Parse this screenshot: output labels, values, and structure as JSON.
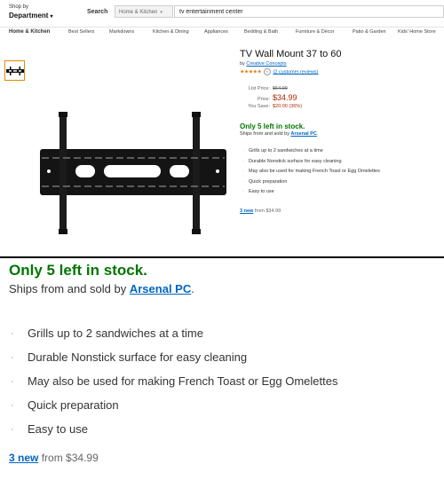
{
  "header": {
    "shop_by": "Shop by",
    "department": "Department",
    "search_label": "Search",
    "search_category": "Home & Kitchen",
    "search_query": "tv entertainment center"
  },
  "subnav": {
    "items": [
      "Home & Kitchen",
      "Best Sellers",
      "Markdowns",
      "Kitchen & Dining",
      "Appliances",
      "Bedding & Bath",
      "Furniture & Décor",
      "Patio & Garden",
      "Kids' Home Store"
    ]
  },
  "product": {
    "title": "TV Wall Mount 37 to 60",
    "by": "by",
    "brand": "Creative Concepts",
    "stars": "★★★★★",
    "reviews": "(2 customer reviews)",
    "list_price_label": "List Price:",
    "list_price": "$54.99",
    "price_label": "Price:",
    "price": "$34.99",
    "save_label": "You Save:",
    "save_value": "$20.00 (36%)",
    "stock": "Only 5 left in stock.",
    "ships_prefix": "Ships from and sold by",
    "seller": "Arsenal PC",
    "features": [
      "Grills up to 2 sandwiches at a time",
      "Durable Nonstick surface for easy cleaning",
      "May also be used for making French Toast or Egg Omelettes",
      "Quick preparation",
      "Easy to use"
    ],
    "new_count": "3 new",
    "new_from": "from $34.99"
  },
  "colors": {
    "stock_green": "#007600",
    "price_red": "#b12704",
    "link_blue": "#0066c0",
    "star_orange": "#e47911"
  }
}
